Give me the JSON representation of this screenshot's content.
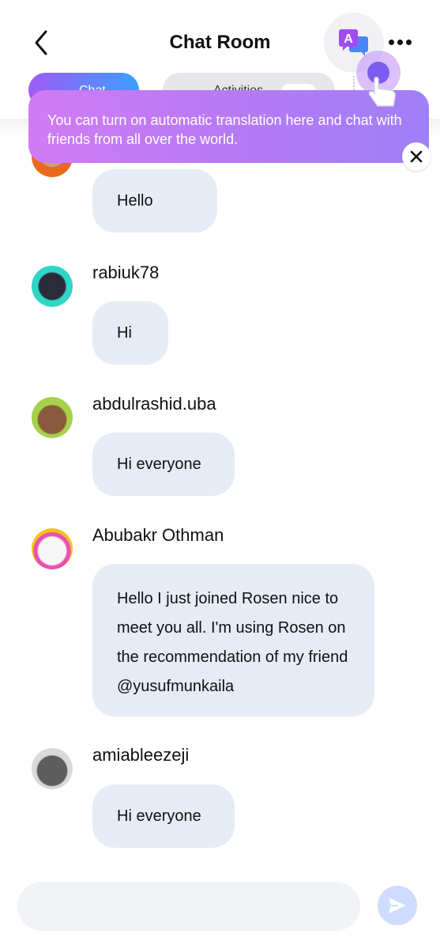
{
  "header": {
    "title": "Chat Room",
    "back_icon": "chevron-left-icon",
    "translate_icon": "translate-icon",
    "more_icon": "more-horizontal-icon"
  },
  "tabs": [
    {
      "label": "Chat",
      "active": true
    },
    {
      "label": "Activities",
      "active": false
    }
  ],
  "tooltip": {
    "text": "You can turn on automatic translation here and chat with friends from all over the world.",
    "close_icon": "close-icon"
  },
  "messages": [
    {
      "user": "",
      "text": "Hello"
    },
    {
      "user": "rabiuk78",
      "text": "Hi"
    },
    {
      "user": "abdulrashid.uba",
      "text": "Hi everyone"
    },
    {
      "user": "Abubakr Othman",
      "text": "Hello I just joined Rosen nice to meet you all. I'm using Rosen on the recommendation of my friend @yusufmunkaila"
    },
    {
      "user": "amiableezeji",
      "text": "Hi everyone"
    }
  ],
  "composer": {
    "placeholder": "",
    "send_icon": "send-icon"
  },
  "colors": {
    "bubble": "#e6ecf6",
    "tooltip_start": "#d07bf4",
    "tooltip_end": "#9f80f7",
    "tab_active_start": "#a05bf6",
    "tab_active_end": "#3aa0ff",
    "send_button": "#cfdcff"
  }
}
